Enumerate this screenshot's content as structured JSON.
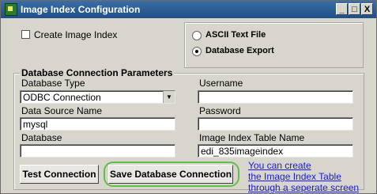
{
  "window": {
    "title": "Image Index Configuration"
  },
  "caption_buttons": {
    "minimize": "_",
    "maximize": "□",
    "close": "X"
  },
  "create_index": {
    "label": "Create Image Index",
    "checked": false
  },
  "output": {
    "options": [
      {
        "label": "ASCII Text File",
        "selected": false
      },
      {
        "label": "Database Export",
        "selected": true
      }
    ]
  },
  "db": {
    "group_title": "Database Connection Parameters",
    "type": {
      "label": "Database Type",
      "value": "ODBC Connection",
      "arrow": "▼"
    },
    "dsn": {
      "label": "Data Source Name",
      "value": "mysql"
    },
    "database": {
      "label": "Database",
      "value": ""
    },
    "username": {
      "label": "Username",
      "value": ""
    },
    "password": {
      "label": "Password",
      "value": ""
    },
    "table": {
      "label": "Image Index Table Name",
      "value": "edi_835imageindex"
    }
  },
  "buttons": {
    "test": "Test Connection",
    "save": "Save Database Connection"
  },
  "note": {
    "line1": "You can create",
    "line2": "the Image Index Table",
    "line3": "through a seperate screen",
    "color": "#1a1ae0"
  },
  "highlight_color": "#5fbf4a"
}
